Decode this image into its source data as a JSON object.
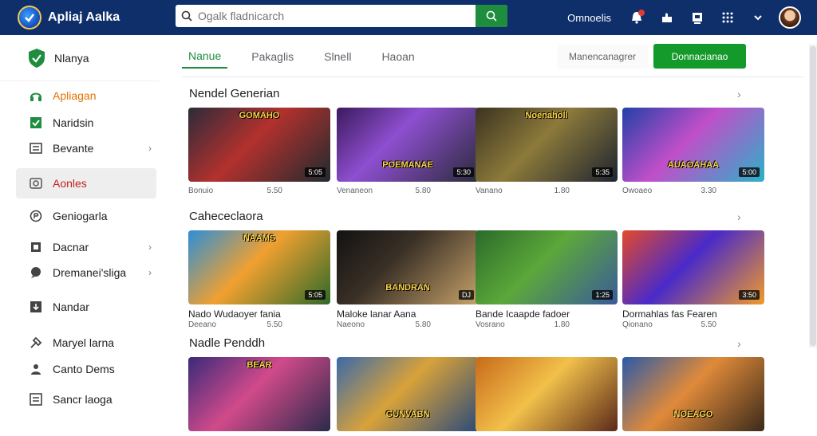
{
  "header": {
    "app_title": "Apliaj Aalka",
    "search_placeholder": "Ogalk fladnicarch",
    "link": "Omnoelis"
  },
  "sidebar": {
    "header_label": "Nlanya",
    "items": [
      {
        "label": "Apliagan",
        "icon": "headphones-icon"
      },
      {
        "label": "Naridsin",
        "icon": "checkbox-icon"
      },
      {
        "label": "Bevante",
        "icon": "list-icon"
      },
      {
        "label": "Aonles",
        "icon": "search-icon"
      },
      {
        "label": "Geniogarla",
        "icon": "gamepad-icon"
      },
      {
        "label": "Dacnar",
        "icon": "bookmark-icon"
      },
      {
        "label": "Dremanei'sliga",
        "icon": "chat-icon"
      },
      {
        "label": "Nandar",
        "icon": "download-icon"
      },
      {
        "label": "Maryel larna",
        "icon": "tools-icon"
      },
      {
        "label": "Canto Dems",
        "icon": "people-icon"
      },
      {
        "label": "Sancr laoga",
        "icon": "grid-icon"
      }
    ]
  },
  "tabs": [
    "Nanue",
    "Pakaglis",
    "Slnell",
    "Haoan"
  ],
  "tab_link": "Manencanagrer",
  "primary_button": "Donnacianao",
  "sections": [
    {
      "title": "Nendel Generian",
      "cards": [
        {
          "badge": "5:05",
          "title": "",
          "meta_left": "Bonuio",
          "meta_right": "5.50",
          "overlay": "GOMAHO"
        },
        {
          "badge": "5:30",
          "title": "",
          "meta_left": "Venaneon",
          "meta_right": "5.80",
          "overlay": "POEMANAE"
        },
        {
          "badge": "5:35",
          "title": "",
          "meta_left": "Vanano",
          "meta_right": "1.80",
          "overlay": "Noenaholl"
        },
        {
          "badge": "5:00",
          "title": "",
          "meta_left": "Owoaeo",
          "meta_right": "3.30",
          "overlay": "AUAOAHAA"
        }
      ]
    },
    {
      "title": "Cahececlaora",
      "cards": [
        {
          "badge": "5:05",
          "title": "Nado Wudaoyer fania",
          "meta_left": "Deeano",
          "meta_right": "5.50",
          "overlay": "NAAMS"
        },
        {
          "badge": "DJ",
          "title": "Maloke lanar Aana",
          "meta_left": "Naeono",
          "meta_right": "5.80",
          "overlay": "BANDRAN"
        },
        {
          "badge": "1:25",
          "title": "Bande Icaapde fadoer",
          "meta_left": "Vosrano",
          "meta_right": "1.80",
          "overlay": ""
        },
        {
          "badge": "3:50",
          "title": "Dormahlas fas Fearen",
          "meta_left": "Qionano",
          "meta_right": "5.50",
          "overlay": ""
        }
      ]
    },
    {
      "title": "Nadle Penddh",
      "cards": [
        {
          "badge": "",
          "title": "",
          "meta_left": "",
          "meta_right": "",
          "overlay": "BEAR"
        },
        {
          "badge": "",
          "title": "",
          "meta_left": "",
          "meta_right": "",
          "overlay": "GUNVABN"
        },
        {
          "badge": "",
          "title": "",
          "meta_left": "",
          "meta_right": "",
          "overlay": ""
        },
        {
          "badge": "",
          "title": "",
          "meta_left": "",
          "meta_right": "",
          "overlay": "NOEAGO"
        }
      ]
    }
  ],
  "colors": {
    "topbar": "#0f2f6b",
    "accent_green": "#1e8e3e",
    "active_red": "#c5221f"
  }
}
